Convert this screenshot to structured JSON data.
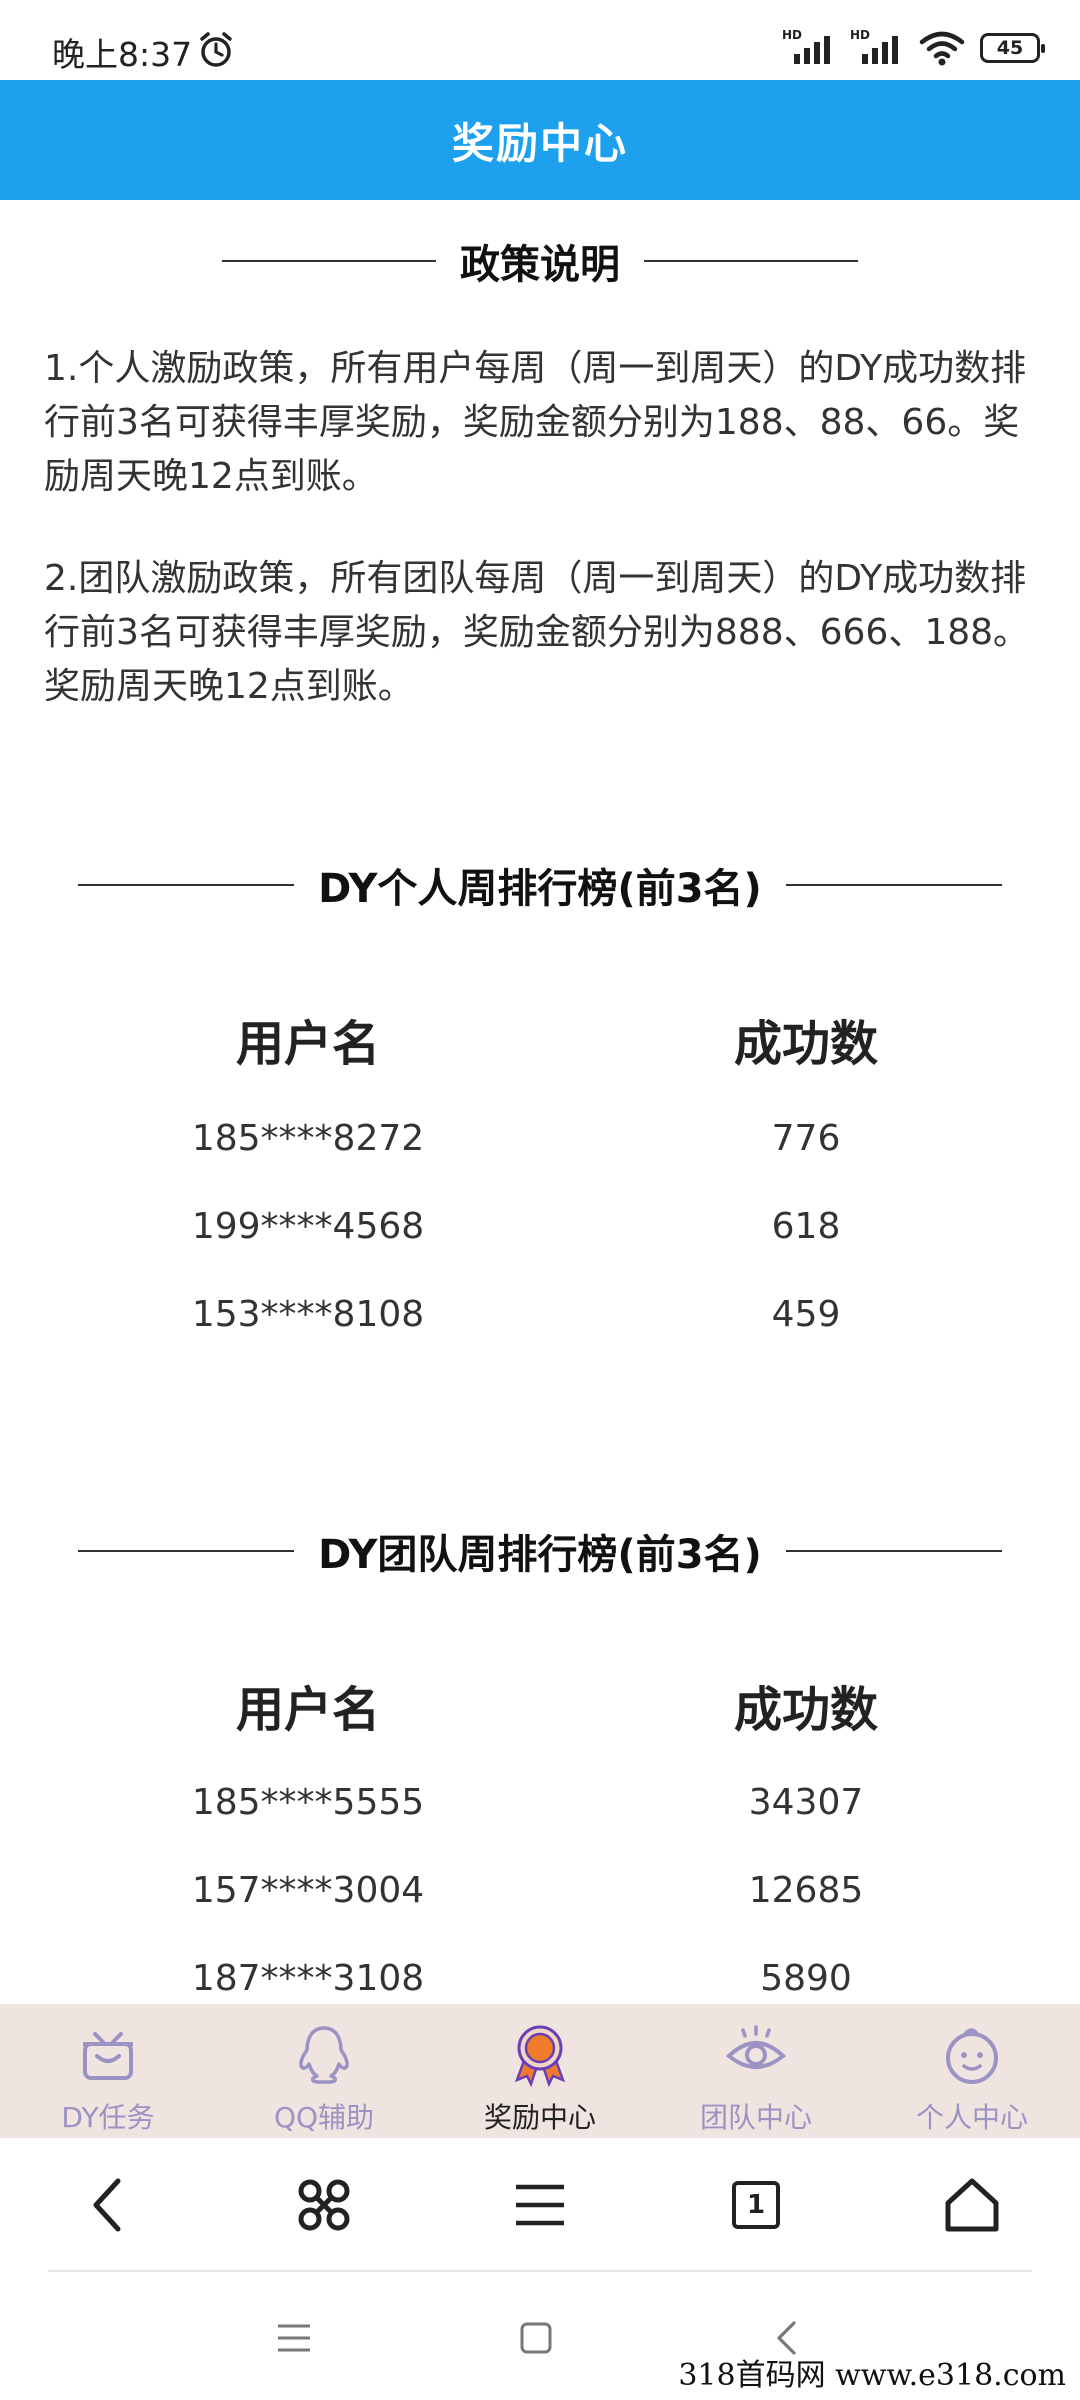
{
  "status_bar": {
    "time": "晚上8:37",
    "signal_label_1": "HD",
    "signal_label_2": "HD",
    "battery": "45"
  },
  "header": {
    "title": "奖励中心"
  },
  "policy": {
    "title": "政策说明",
    "items": [
      "1.个人激励政策，所有用户每周（周一到周天）的DY成功数排行前3名可获得丰厚奖励，奖励金额分别为188、88、66。奖励周天晚12点到账。",
      "2.团队激励政策，所有团队每周（周一到周天）的DY成功数排行前3名可获得丰厚奖励，奖励金额分别为888、666、188。奖励周天晚12点到账。"
    ]
  },
  "personal_rank": {
    "title": "DY个人周排行榜(前3名)",
    "col_user": "用户名",
    "col_count": "成功数",
    "rows": [
      {
        "user": "185****8272",
        "count": "776"
      },
      {
        "user": "199****4568",
        "count": "618"
      },
      {
        "user": "153****8108",
        "count": "459"
      }
    ]
  },
  "team_rank": {
    "title": "DY团队周排行榜(前3名)",
    "col_user": "用户名",
    "col_count": "成功数",
    "rows": [
      {
        "user": "185****5555",
        "count": "34307"
      },
      {
        "user": "157****3004",
        "count": "12685"
      },
      {
        "user": "187****3108",
        "count": "5890"
      }
    ]
  },
  "tabbar": {
    "items": [
      {
        "label": "DY任务",
        "icon": "gift-box-icon"
      },
      {
        "label": "QQ辅助",
        "icon": "penguin-icon"
      },
      {
        "label": "奖励中心",
        "icon": "medal-icon",
        "active": true
      },
      {
        "label": "团队中心",
        "icon": "eye-icon"
      },
      {
        "label": "个人中心",
        "icon": "smiley-icon"
      }
    ]
  },
  "browser_toolbar": {
    "tab_count": "1"
  },
  "watermark": "318首码网  www.e318.com",
  "colors": {
    "header_bg": "#1da1ee",
    "tabbar_bg": "#efe4df",
    "tab_inactive": "#9b93c3",
    "tab_active_medal": "#f07b2a"
  }
}
